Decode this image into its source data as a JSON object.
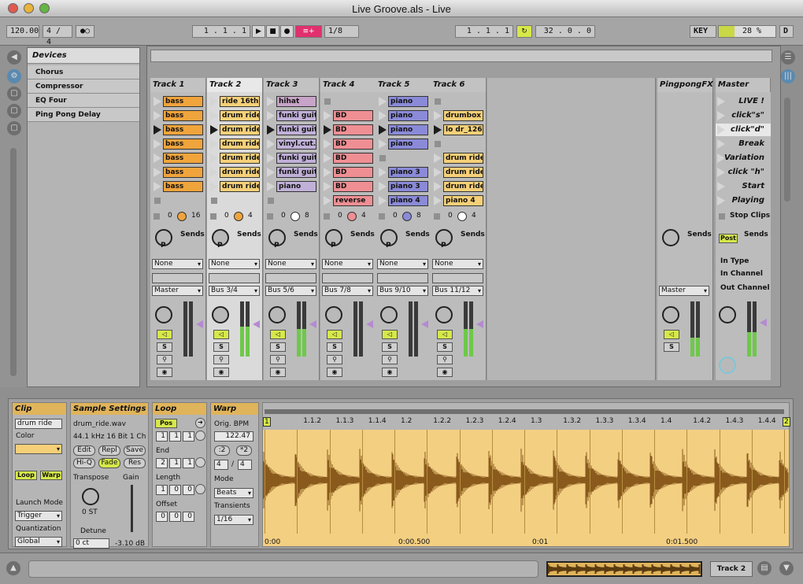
{
  "window": {
    "title": "Live Groove.als - Live"
  },
  "control": {
    "tempo": "120.00",
    "signature": "4 / 4",
    "arrangement_pos": "1 . 1 . 1",
    "quantize": "1/8",
    "loop_start": "1 . 1 . 1",
    "loop_length": "32 . 0 . 0",
    "key_label": "KEY",
    "cpu": "28 %",
    "cpu_fraction": 0.28,
    "d_label": "D"
  },
  "browser": {
    "header": "Devices",
    "items": [
      "Chorus",
      "Compressor",
      "EQ Four",
      "Ping Pong Delay"
    ]
  },
  "tracks": [
    {
      "name": "Track 1",
      "clips": [
        "bass",
        "bass",
        "bass",
        "bass",
        "bass",
        "bass",
        "bass",
        ""
      ],
      "color": "#f0a43c",
      "playing": 2,
      "knob_color": "#f0a43c",
      "num": "16",
      "output": "Master",
      "in": "None",
      "meter": 0.0
    },
    {
      "name": "Track 2",
      "clips": [
        "ride 16th",
        "drum ride",
        "drum ride",
        "drum ride",
        "drum ride",
        "drum ride",
        "drum ride",
        ""
      ],
      "color": "#f5d078",
      "playing": 2,
      "knob_color": "#f0a43c",
      "num": "4",
      "output": "Bus 3/4",
      "in": "None",
      "meter": 0.55
    },
    {
      "name": "Track 3",
      "clips": [
        "hihat",
        "funki guita",
        "funki guita",
        "vinyl.cut.1",
        "funki guita",
        "funki guita",
        "piano",
        ""
      ],
      "color": "#c0b0d8",
      "playing": 2,
      "knob_color": "#ffffff",
      "num": "8",
      "output": "Bus 5/6",
      "in": "None",
      "meter": 0.5
    },
    {
      "name": "Track 4",
      "clips": [
        "",
        "BD",
        "BD",
        "BD",
        "BD",
        "BD",
        "BD",
        "reverse"
      ],
      "color": "#ef8f94",
      "playing": 2,
      "knob_color": "#ef8f94",
      "num": "4",
      "output": "Bus 7/8",
      "in": "None",
      "meter": 0.0
    },
    {
      "name": "Track 5",
      "clips": [
        "piano",
        "piano",
        "piano",
        "piano",
        "",
        "piano 3",
        "piano 3",
        "piano 4"
      ],
      "color": "#8a8ad8",
      "playing": 2,
      "knob_color": "#8a8ad8",
      "num": "8",
      "output": "Bus 9/10",
      "in": "None",
      "meter": 0.0
    },
    {
      "name": "Track 6",
      "clips": [
        "",
        "drumbox a",
        "lo dr_126",
        "",
        "drum ride",
        "drum ride",
        "drum ride",
        "piano 4"
      ],
      "color": "#f5d078",
      "playing": 2,
      "knob_color": "#ffffff",
      "num": "4",
      "output": "Bus 11/12",
      "in": "None",
      "meter": 0.5
    }
  ],
  "return_track": {
    "name": "PingpongFX",
    "output": "Master"
  },
  "master": {
    "name": "Master",
    "scenes": [
      "LIVE !",
      "click\"s\"",
      "click\"d\"",
      "Break",
      "Variation",
      "click \"h\"",
      "Start",
      "Playing"
    ],
    "stop_clips": "Stop Clips",
    "post": "Post",
    "in_type": "In Type",
    "in_channel": "In Channel",
    "out_channel": "Out Channel"
  },
  "labels": {
    "sends": "Sends",
    "p": "P",
    "s": "S",
    "zero": "0"
  },
  "detail": {
    "clip": {
      "header": "Clip",
      "name": "drum ride",
      "color_label": "Color",
      "loop": "Loop",
      "warp": "Warp",
      "launch_mode": "Launch Mode",
      "launch_value": "Trigger",
      "quantization": "Quantization",
      "quant_value": "Global"
    },
    "sample": {
      "header": "Sample Settings",
      "file": "drum_ride.wav",
      "info": "44.1 kHz 16 Bit 1 Ch",
      "edit": "Edit",
      "repl": "Repl",
      "save": "Save",
      "hiq": "Hi-Q",
      "fade": "Fade",
      "res": "Res",
      "transpose": "Transpose",
      "gain": "Gain",
      "st": "0 ST",
      "detune": "Detune",
      "detune_value": "0 ct",
      "gain_value": "-3.10 dB"
    },
    "loop": {
      "header": "Loop",
      "pos": "Pos",
      "start": [
        "1",
        "1",
        "1"
      ],
      "end_label": "End",
      "end": [
        "2",
        "1",
        "1"
      ],
      "length_label": "Length",
      "length": [
        "1",
        "0",
        "0"
      ],
      "offset_label": "Offset",
      "offset": [
        "0",
        "0",
        "0"
      ]
    },
    "warp": {
      "header": "Warp",
      "orig_bpm": "Orig. BPM",
      "bpm": "122.47",
      "half": ":2",
      "dbl": "*2",
      "sig_num": "4",
      "sig_den": "4",
      "mode_label": "Mode",
      "mode": "Beats",
      "transients_label": "Transients",
      "transients": "1/16"
    },
    "ruler": [
      "1",
      "1.1.2",
      "1.1.3",
      "1.1.4",
      "1.2",
      "1.2.2",
      "1.2.3",
      "1.2.4",
      "1.3",
      "1.3.2",
      "1.3.3",
      "1.3.4",
      "1.4",
      "1.4.2",
      "1.4.3",
      "1.4.4",
      "2"
    ],
    "time": [
      "0:00",
      "0:00.500",
      "0:01",
      "0:01.500"
    ]
  },
  "status": {
    "track": "Track 2"
  }
}
